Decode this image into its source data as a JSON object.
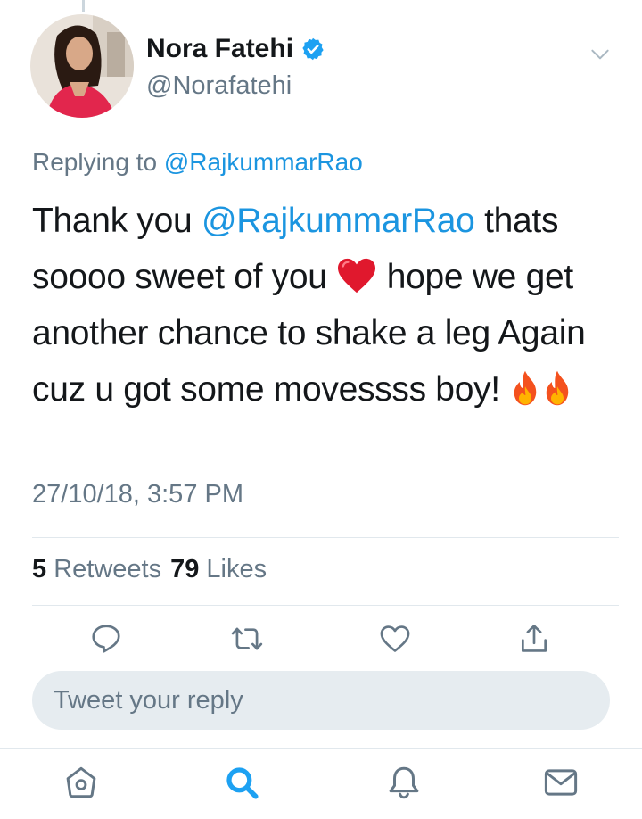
{
  "tweet": {
    "author": {
      "name": "Nora Fatehi",
      "handle": "@Norafatehi",
      "verified": true
    },
    "replying_prefix": "Replying to",
    "replying_to": "@RajkummarRao",
    "text": {
      "part1": "Thank you ",
      "mention": "@RajkummarRao",
      "part2": " thats soooo sweet of you ",
      "part3": " hope we get another chance to shake a leg Again cuz u got some movessss boy! "
    },
    "emojis": [
      "red-heart",
      "fire",
      "fire"
    ],
    "timestamp": "27/10/18, 3:57 PM",
    "retweets_count": "5",
    "retweets_label": "Retweets",
    "likes_count": "79",
    "likes_label": "Likes"
  },
  "actions": [
    "reply-icon",
    "retweet-icon",
    "like-icon",
    "share-icon"
  ],
  "reply_box": {
    "placeholder": "Tweet your reply"
  },
  "bottom_nav": [
    "home-icon",
    "search-icon",
    "notifications-icon",
    "messages-icon"
  ],
  "colors": {
    "accent": "#1b95e0",
    "secondary_text": "#657786",
    "primary_text": "#14171a",
    "divider": "#e1e8ed",
    "reply_box_bg": "#e6ecf0",
    "icon_gray": "#657786"
  }
}
